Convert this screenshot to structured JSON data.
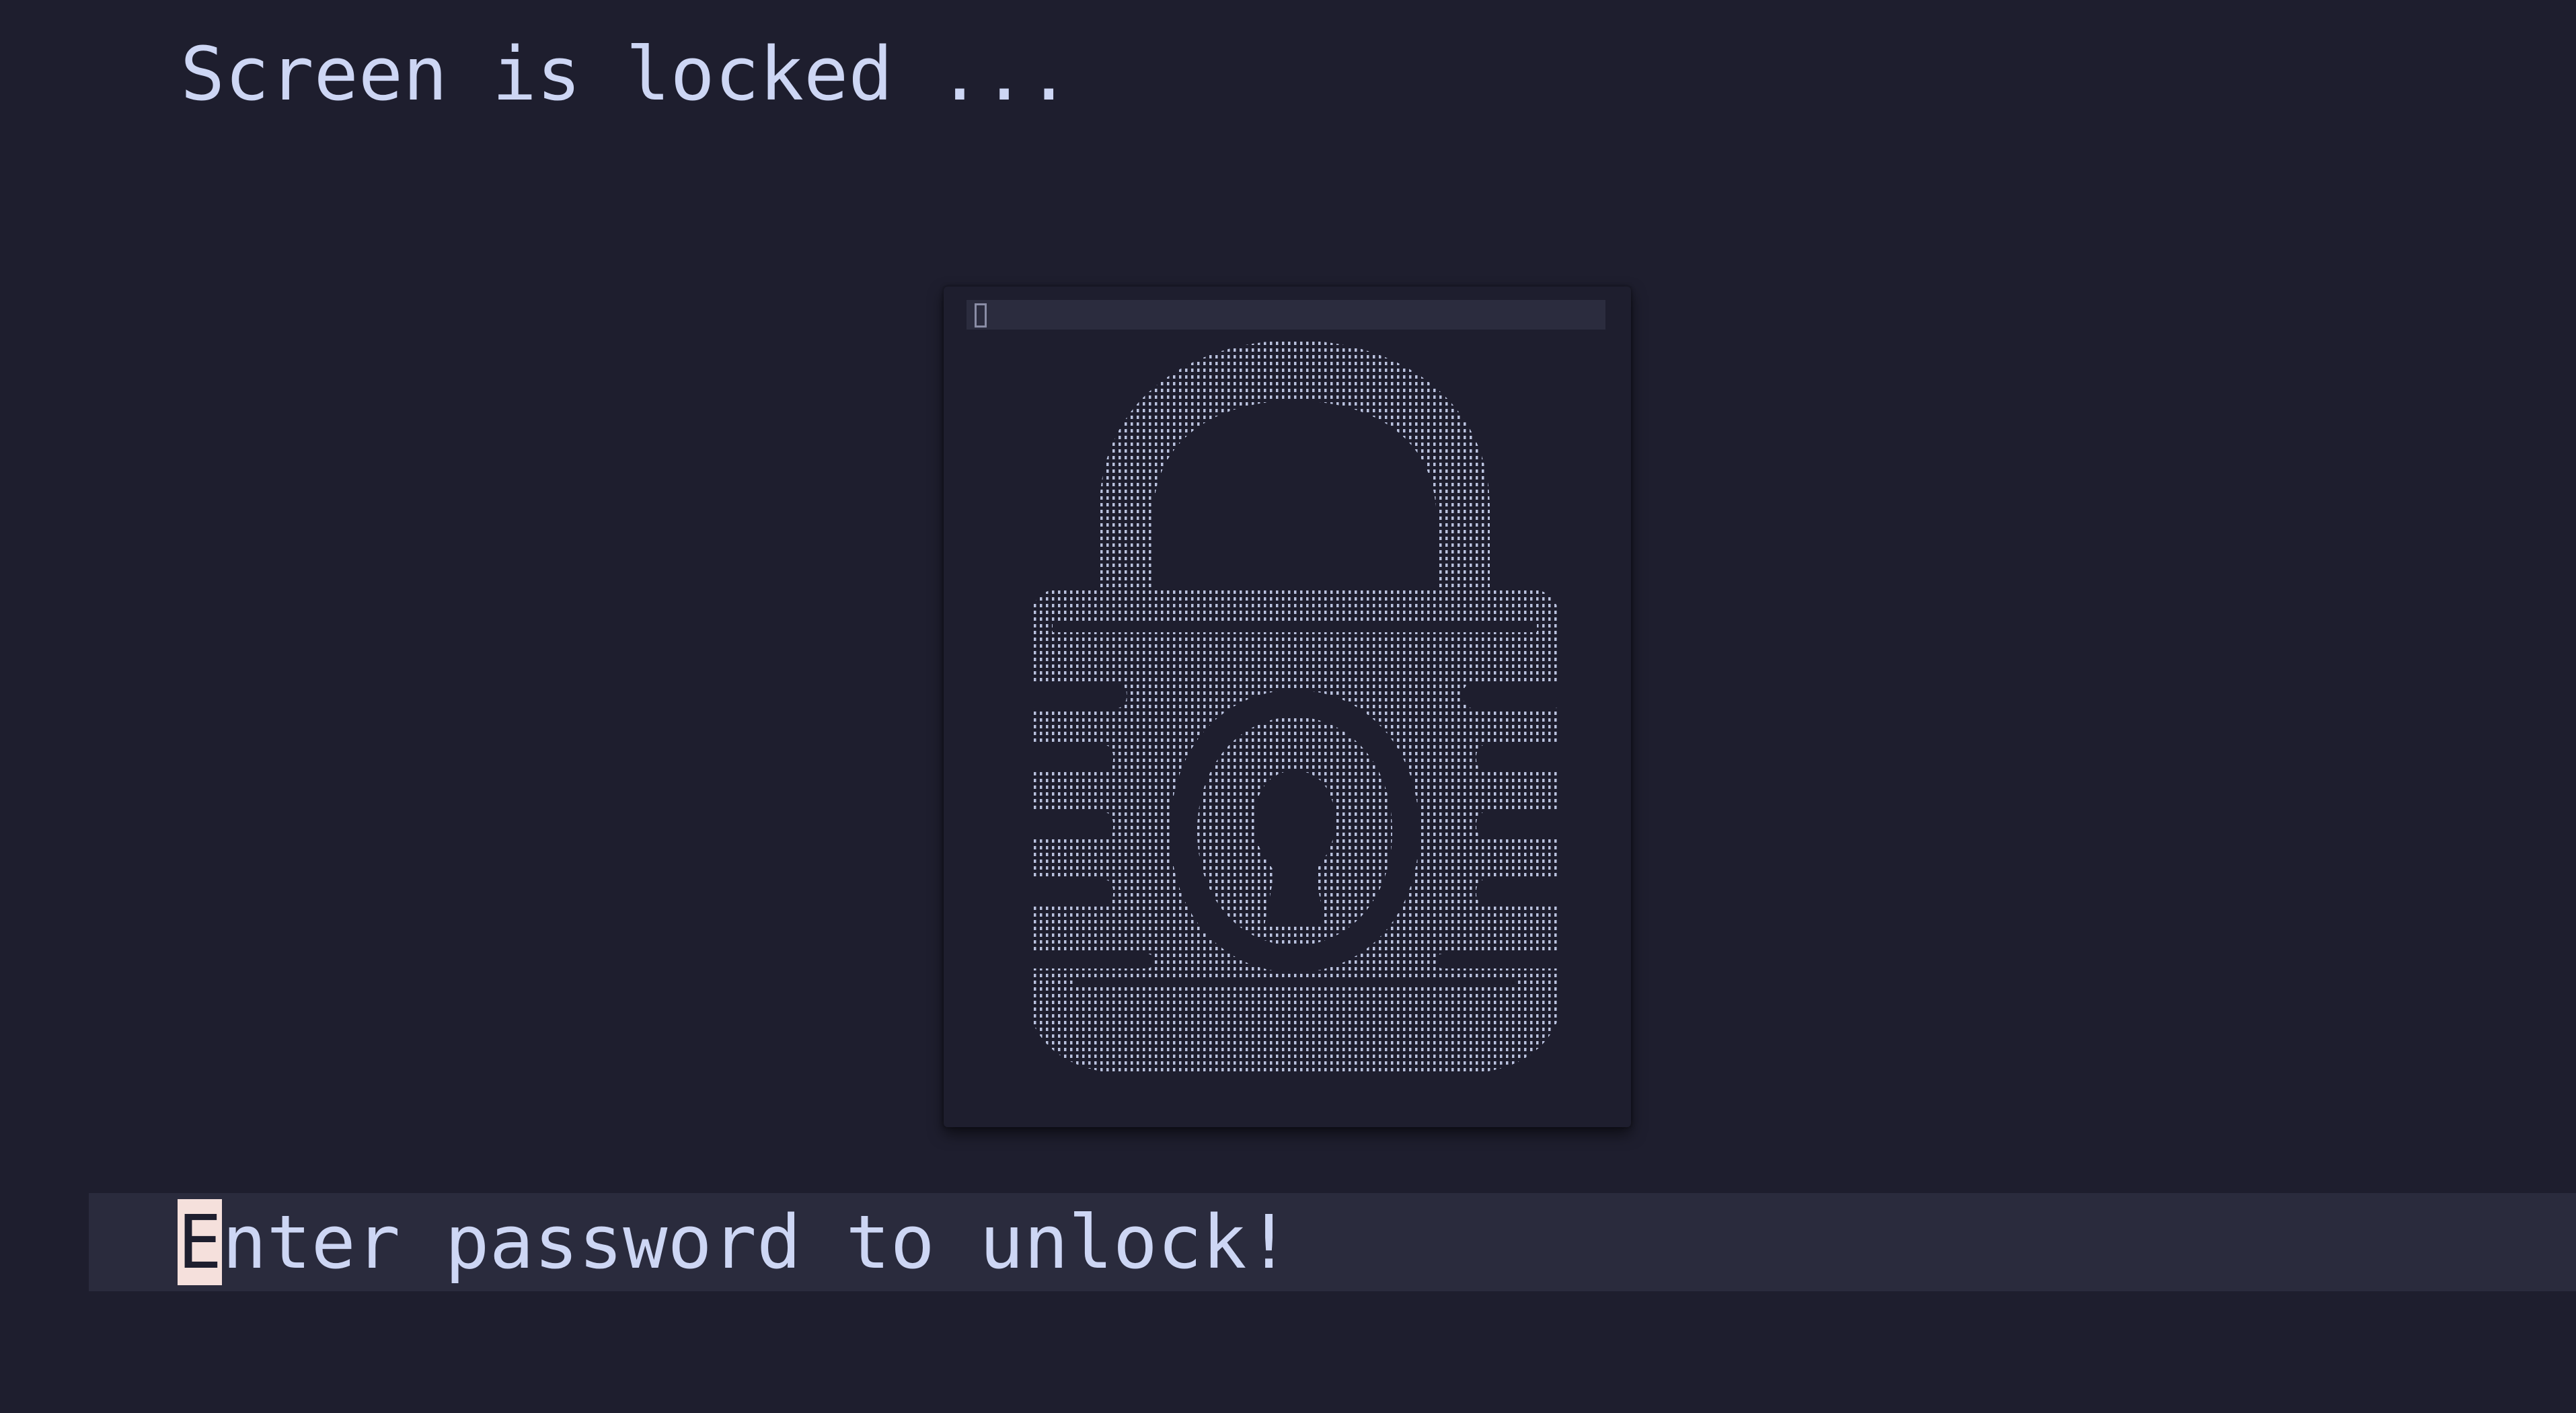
{
  "lock_screen": {
    "title": "Screen is locked ...",
    "prompt_first_char": "E",
    "prompt_rest": "nter password to unlock!"
  },
  "popup": {
    "icon": "padlock-icon"
  },
  "colors": {
    "background": "#1e1e2e",
    "text": "#cdd6f4",
    "prompt_bar": "#2a2b3d",
    "cursor": "#f5e0dc",
    "ascii_dots": "#bac2de"
  }
}
